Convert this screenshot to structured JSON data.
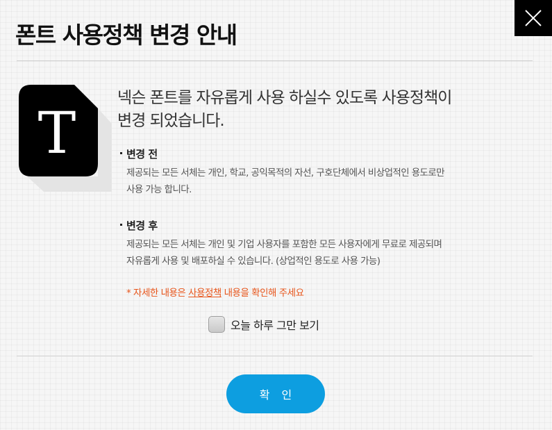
{
  "header": {
    "title": "폰트 사용정책 변경 안내",
    "close_icon": "close-icon"
  },
  "icon": {
    "name": "font-document-icon",
    "letter": "T"
  },
  "main": {
    "headline_line1": "넥슨 폰트를 자유롭게 사용 하실수 있도록 사용정책이",
    "headline_line2": "변경 되었습니다.",
    "before": {
      "title": "변경 전",
      "line1": "제공되는 모든 서체는 개인, 학교, 공익목적의 자선, 구호단체에서 비상업적인 용도로만",
      "line2": "사용 가능 합니다."
    },
    "after": {
      "title": "변경 후",
      "line1": "제공되는 모든 서체는 개인 및 기업 사용자를 포함한 모든 사용자에게 무료로 제공되며",
      "line2": "자유롭게 사용 및 배포하실 수 있습니다. (상업적인 용도로 사용 가능)"
    },
    "notice": {
      "prefix": "* 자세한 내용은 ",
      "link": "사용정책",
      "suffix": " 내용을 확인해 주세요"
    }
  },
  "dismiss": {
    "label": "오늘 하루 그만 보기",
    "checked": false
  },
  "footer": {
    "confirm_label": "확 인"
  },
  "colors": {
    "accent": "#0d9ee0",
    "notice": "#e8561c",
    "dark": "#000000"
  }
}
